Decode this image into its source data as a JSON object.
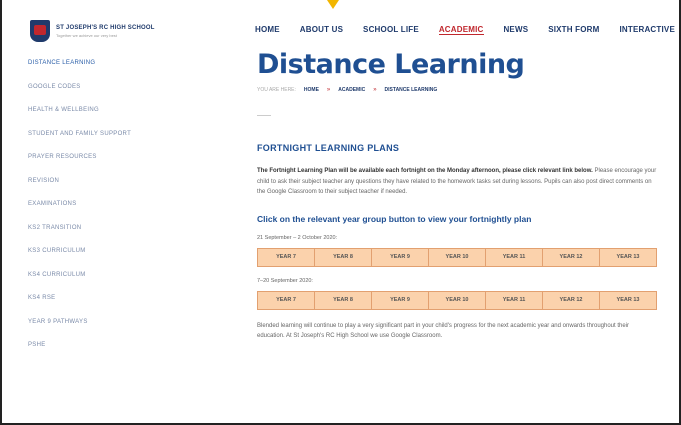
{
  "header": {
    "school_name": "ST JOSEPH'S RC HIGH SCHOOL",
    "tagline": "Together we achieve our very best",
    "nav": [
      "HOME",
      "ABOUT US",
      "SCHOOL LIFE",
      "ACADEMIC",
      "NEWS",
      "SIXTH FORM",
      "INTERACTIVE"
    ],
    "active_nav": "ACADEMIC"
  },
  "sidebar": {
    "items": [
      "DISTANCE LEARNING",
      "GOOGLE CODES",
      "HEALTH & WELLBEING",
      "STUDENT AND FAMILY SUPPORT",
      "PRAYER RESOURCES",
      "REVISION",
      "EXAMINATIONS",
      "KS2 TRANSITION",
      "KS3 CURRICULUM",
      "KS4 CURRICULUM",
      "KS4 RSE",
      "YEAR 9 PATHWAYS",
      "PSHE"
    ],
    "active_index": 0
  },
  "main": {
    "title": "Distance Learning",
    "breadcrumb_prefix": "YOU ARE HERE:",
    "breadcrumb": [
      "HOME",
      "ACADEMIC",
      "DISTANCE LEARNING"
    ],
    "breadcrumb_separator": "»",
    "section_title": "FORTNIGHT LEARNING PLANS",
    "intro_bold": "The Fortnight Learning Plan will be available each fortnight on the Monday afternoon, please click relevant link below.",
    "intro_rest": " Please encourage your child to ask their subject teacher any questions they have related to the homework tasks set during lessons. Pupils can also post direct comments on the Google Classroom to their subject teacher if needed.",
    "cta": "Click on the relevant year group button to view your fortnightly plan",
    "periods": [
      {
        "label": "21 September – 2 October 2020:",
        "buttons": [
          "YEAR 7",
          "YEAR 8",
          "YEAR 9",
          "YEAR 10",
          "YEAR 11",
          "YEAR 12",
          "YEAR 13"
        ]
      },
      {
        "label": "7–20 September 2020:",
        "buttons": [
          "YEAR 7",
          "YEAR 8",
          "YEAR 9",
          "YEAR 10",
          "YEAR 11",
          "YEAR 12",
          "YEAR 13"
        ]
      }
    ],
    "closing": "Blended learning will continue to play a very significant part in your child's progress for the next academic year and onwards throughout their education. At St Joseph's RC High School we use Google Classroom."
  },
  "colors": {
    "brand_blue": "#1f4f92",
    "accent_red": "#c0272d",
    "button_fill": "#fbd2ac",
    "button_border": "#e2a070",
    "pointer": "#f2b600"
  }
}
